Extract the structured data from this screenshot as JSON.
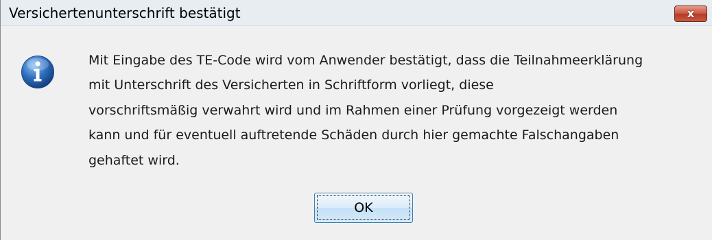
{
  "window": {
    "title": "Versichertenunterschrift bestätigt",
    "close_label": "x"
  },
  "message": {
    "lines": [
      "Mit Eingabe des TE-Code wird vom Anwender bestätigt, dass die Teilnahmeerklärung",
      "mit Unterschrift des Versicherten in Schriftform vorliegt, diese",
      "vorschriftsmäßig verwahrt wird und im Rahmen einer Prüfung vorgezeigt werden",
      "kann und für eventuell auftretende Schäden durch hier gemachte Falschangaben",
      "gehaftet wird."
    ]
  },
  "buttons": {
    "ok_label": "OK"
  },
  "icons": {
    "info": "info-icon",
    "close": "close-icon"
  },
  "colors": {
    "dialog_background": "#f0f0f0",
    "close_button": "#c9533f",
    "info_icon": "#2f6fbf",
    "ok_button_border": "#3c7fb1"
  }
}
